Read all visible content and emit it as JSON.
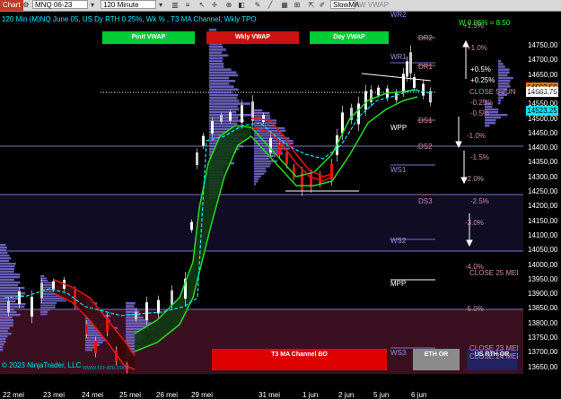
{
  "toolbar": {
    "app_label": "Chart",
    "instrument": "MNQ 06-23",
    "interval": "120 Minute",
    "indicator1": "SlowMA",
    "indicator2": "W VWAP"
  },
  "header": {
    "title": "120 Min (M)NQ June 05, US Dy RTH 0.25%, Wk % , T3 MA Channel, Wkly TPO",
    "wvwap": "W 0.05% = 8.50"
  },
  "buttons": {
    "pinit_vwap": "Pinit VWAP",
    "wkly_vwap": "Wkly VWAP",
    "day_vwap": "Day VWAP",
    "t3_channel_bo": "T3 MA Channel BO",
    "eth_or": "ETH OR",
    "us_rth_or": "US RTH OR"
  },
  "levels": {
    "wr2": "WR2",
    "dr2": "DR2",
    "wr1": "WR1",
    "dr1": "DR1",
    "wpp": "WPP",
    "ds1": "DS1",
    "ds2": "DS2",
    "ws1": "WS1",
    "ds3": "DS3",
    "ws2": "WS2",
    "mpp": "MPP",
    "ws3": "WS3"
  },
  "pct_labels": {
    "p15": "+1.5%",
    "p10": "+1.0%",
    "p05": "+0.5%",
    "p025": "+0.25%",
    "m025": "-0.25%",
    "m05": "-0.5%",
    "m10": "-1.0%",
    "m15": "-1.5%",
    "m20": "-2.0%",
    "m25": "-2.5%",
    "m30": "-3.0%",
    "m40": "-4.0%",
    "m50": "-5.0%"
  },
  "close_labels": {
    "c5jun": "CLOSE 5 JUN",
    "c25": "CLOSE 25 MEI",
    "c23": "CLOSE 23 MEI",
    "c24": "CLOSE 24 MEI"
  },
  "price_boxes": {
    "upper": "14583.75",
    "lower": "14523.25",
    "hidden": "14603.50"
  },
  "y_axis": [
    "14750,00",
    "14700,00",
    "14650,00",
    "14600,00",
    "14550,00",
    "14500,00",
    "14450,00",
    "14400,00",
    "14350,00",
    "14300,00",
    "14250,00",
    "14200,00",
    "14150,00",
    "14100,00",
    "14050,00",
    "14000,00",
    "13950,00",
    "13900,00",
    "13850,00",
    "13800,00",
    "13750,00",
    "13700,00",
    "13650,00"
  ],
  "x_axis": [
    "22 mei",
    "23 mei",
    "24 mei",
    "25 mei",
    "26 mei",
    "29 mei",
    "31 mei",
    "1 jun",
    "2 jun",
    "5 jun",
    "6 jun"
  ],
  "footer": {
    "copyright": "© 2023 NinjaTrader, LLC",
    "watermark": "www.fin-ani.com"
  },
  "colors": {
    "green_band": "#00c000",
    "red_band": "#cc0000",
    "profile": "#7b6fd6",
    "cyan": "#00e5ff"
  }
}
